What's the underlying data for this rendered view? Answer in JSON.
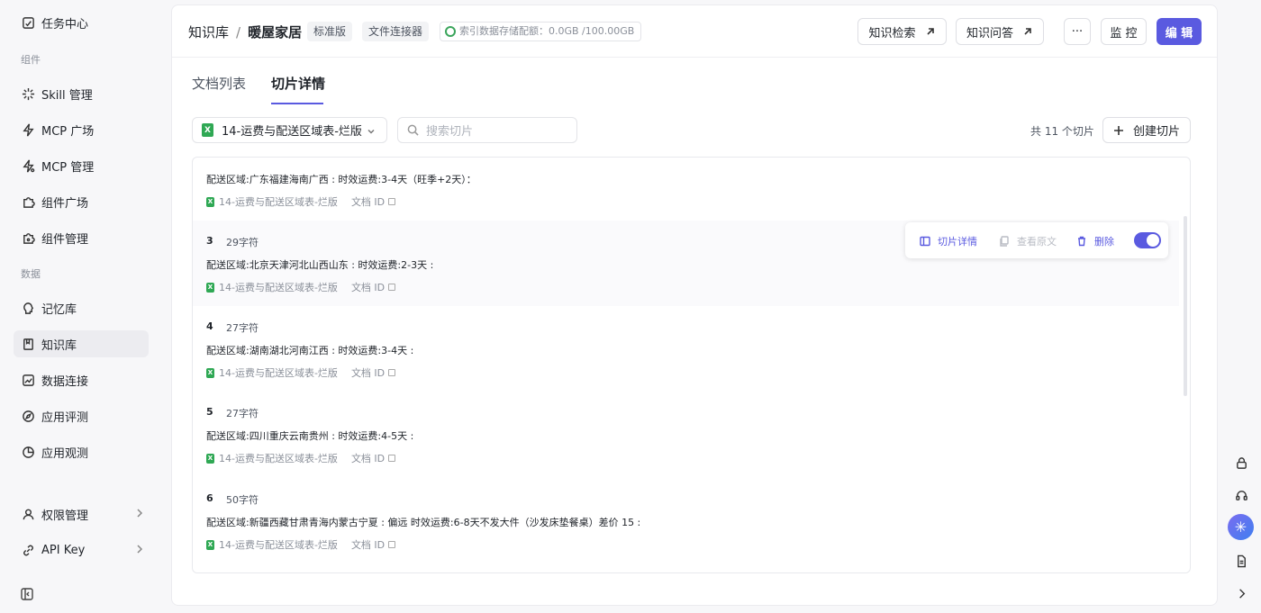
{
  "sidebar": {
    "top_item": "任务中心",
    "section_components": "组件",
    "components": [
      "Skill 管理",
      "MCP 广场",
      "MCP 管理",
      "组件广场",
      "组件管理"
    ],
    "section_data": "数据",
    "data_items": [
      "记忆库",
      "知识库",
      "数据连接",
      "应用评测",
      "应用观测"
    ],
    "bottom_items": [
      "权限管理",
      "API Key"
    ]
  },
  "header": {
    "crumb_root": "知识库",
    "crumb_sep": "/",
    "crumb_current": "暖屋家居",
    "tag_edition": "标准版",
    "tag_type": "文件连接器",
    "quota_text": "索引数据存储配额：0.0GB /100.00GB",
    "btn_search": "知识检索",
    "btn_qa": "知识问答",
    "btn_more": "···",
    "btn_monitor": "监 控",
    "btn_edit": "编 辑"
  },
  "tabs": [
    "文档列表",
    "切片详情"
  ],
  "toolbar": {
    "doc_name": "14-运费与配送区域表-烂版",
    "search_placeholder": "搜索切片",
    "count_text": "共 11 个切片",
    "create_label": "创建切片"
  },
  "chunks": [
    {
      "num": "",
      "chars": "",
      "text": "配送区域:广东福建海南广西 : 时效运费:3-4天（旺季+2天）：",
      "source": "14-运费与配送区域表-烂版",
      "doc_id": "文档 ID"
    },
    {
      "num": "3",
      "chars": "29字符",
      "text": "配送区域:北京天津河北山西山东 : 时效运费:2-3天 :",
      "source": "14-运费与配送区域表-烂版",
      "doc_id": "文档 ID"
    },
    {
      "num": "4",
      "chars": "27字符",
      "text": "配送区域:湖南湖北河南江西 : 时效运费:3-4天 :",
      "source": "14-运费与配送区域表-烂版",
      "doc_id": "文档 ID"
    },
    {
      "num": "5",
      "chars": "27字符",
      "text": "配送区域:四川重庆云南贵州 : 时效运费:4-5天 :",
      "source": "14-运费与配送区域表-烂版",
      "doc_id": "文档 ID"
    },
    {
      "num": "6",
      "chars": "50字符",
      "text": "配送区域:新疆西藏甘肃青海内蒙古宁夏 : 偏远 时效运费:6-8天不发大件（沙发床垫餐桌）差价 15 :",
      "source": "14-运费与配送区域表-烂版",
      "doc_id": "文档 ID"
    }
  ],
  "chunk_actions": {
    "detail": "切片详情",
    "view_original": "查看原文",
    "delete": "删除"
  },
  "colors": {
    "accent": "#5a5ae0",
    "excel_green": "#2fa854"
  }
}
